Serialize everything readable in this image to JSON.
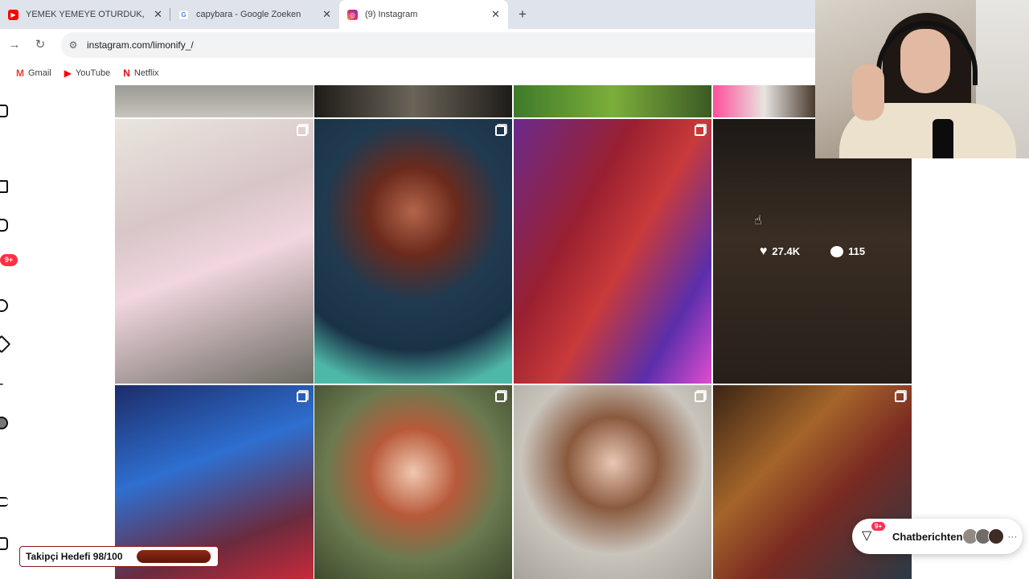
{
  "browser": {
    "tabs": [
      {
        "title": "YEMEK YEMEYE OTURDUK, AZ",
        "favicon": "youtube-icon",
        "active": false
      },
      {
        "title": "capybara - Google Zoeken",
        "favicon": "google-icon",
        "active": false
      },
      {
        "title": "(9) Instagram",
        "favicon": "instagram-icon",
        "active": true
      }
    ],
    "url": "instagram.com/limonify_/",
    "bookmarks": [
      {
        "label": "Gmail",
        "icon": "gmail-icon"
      },
      {
        "label": "YouTube",
        "icon": "youtube-icon"
      },
      {
        "label": "Netflix",
        "icon": "netflix-icon"
      }
    ]
  },
  "instagram": {
    "notification_badge": "9+",
    "hovered_post": {
      "likes": "27.4K",
      "comments": "115"
    }
  },
  "overlays": {
    "follower_goal_label": "Takipçi Hedefi 98/100",
    "follower_goal_progress": 0.98,
    "chat_notifications_badge": "9+",
    "chat_label": "Chatberichten",
    "chat_more": "···"
  },
  "colors": {
    "instagram_badge": "#ff3040",
    "goal_fill": "#6e1c0c",
    "chat_badge": "#ff2d55"
  }
}
